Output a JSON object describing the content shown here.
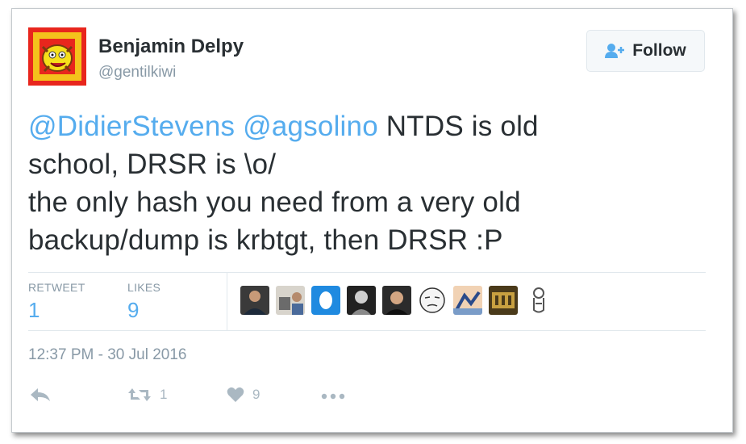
{
  "user": {
    "name": "Benjamin Delpy",
    "handle": "@gentilkiwi",
    "follow_label": "Follow"
  },
  "tweet": {
    "mention1": "@DidierStevens",
    "mention2": "@agsolino",
    "line1_rest": " NTDS is old",
    "line2": "school, DRSR is \\o/",
    "line3": "the only hash you need from a very old",
    "line4": "backup/dump is krbtgt, then DRSR :P"
  },
  "stats": {
    "retweets_label": "RETWEET",
    "retweets": "1",
    "likes_label": "LIKES",
    "likes": "9"
  },
  "timestamp": "12:37 PM - 30 Jul 2016",
  "actions": {
    "retweet_count": "1",
    "like_count": "9"
  },
  "colors": {
    "mention": "#55acee",
    "text": "#292f33",
    "muted": "#8899a6",
    "action": "#aab8c2"
  },
  "icons": [
    "follow-person-icon",
    "reply-icon",
    "retweet-icon",
    "heart-icon",
    "more-icon"
  ]
}
